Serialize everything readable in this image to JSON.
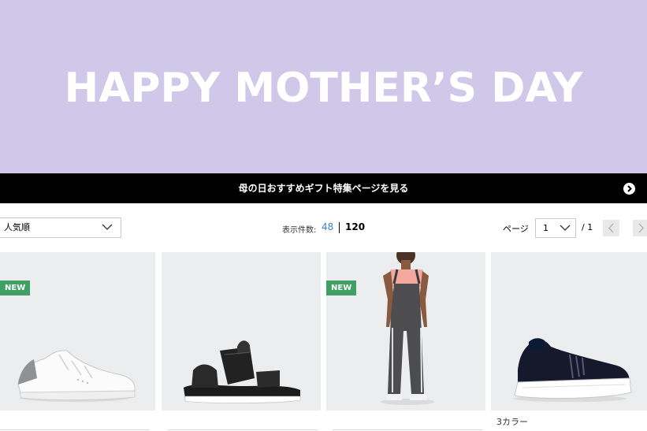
{
  "hero": {
    "title": "HAPPY MOTHER’S DAY",
    "background": "#cfc8e8"
  },
  "gift_banner": {
    "label": "母の日おすすめギフト特集ページを見る"
  },
  "toolbar": {
    "sort": {
      "selected": "人気順"
    },
    "display_count": {
      "label": "表示件数:",
      "options": [
        "48",
        "120"
      ]
    },
    "pagination": {
      "label": "ページ",
      "current": "1",
      "total": "/ 1"
    }
  },
  "products": [
    {
      "badge": "NEW",
      "image": "white-sneaker"
    },
    {
      "badge": "",
      "image": "black-sandal"
    },
    {
      "badge": "NEW",
      "image": "grey-overalls-model"
    },
    {
      "badge": "",
      "image": "black-knit-sneaker",
      "colors": "3カラー"
    }
  ],
  "colors": {
    "new_badge": "#3f9f64",
    "count_link": "#3a82c9"
  }
}
